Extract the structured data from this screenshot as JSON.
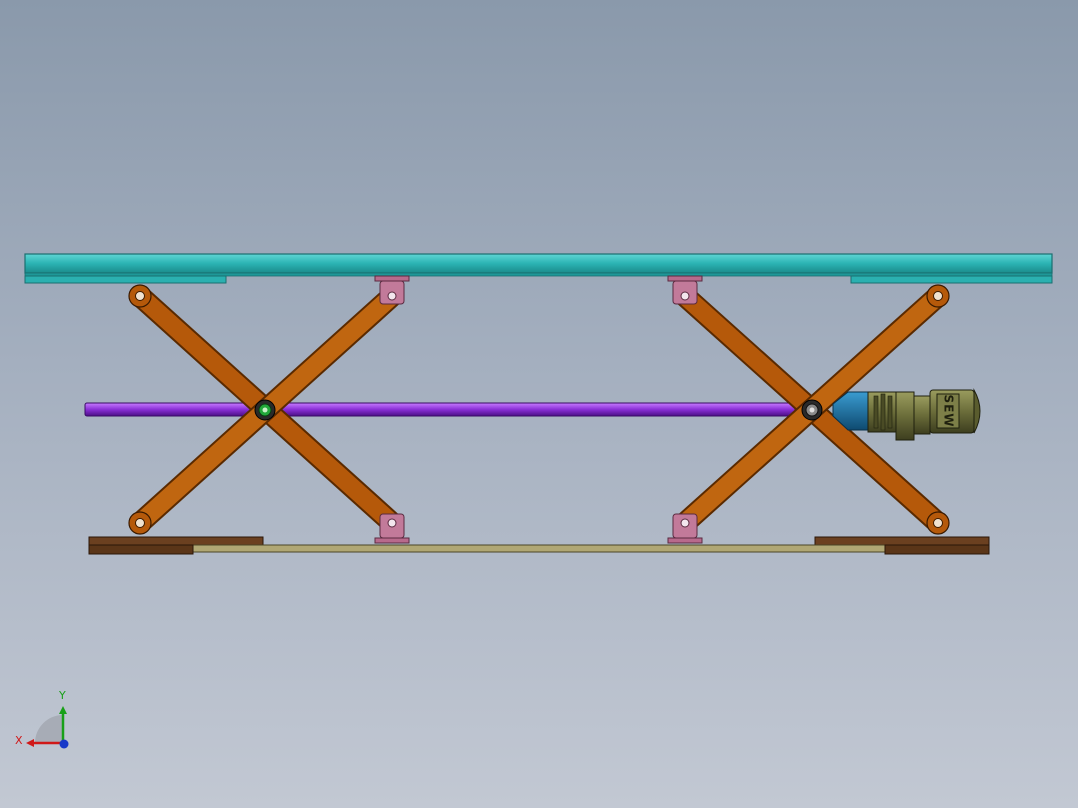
{
  "motor": {
    "brand_text": "SEW"
  },
  "triad": {
    "x_label": "X",
    "y_label": "Y"
  },
  "colors": {
    "platform": "#2fb8b8",
    "platform_edge": "#1a6f70",
    "scissor_arm": "#b5590a",
    "scissor_arm_edge": "#5a2a00",
    "bracket": "#c27a9a",
    "shaft": "#8a2fd6",
    "base_rail": "#5a3518",
    "base_bar": "#b0a774",
    "motor_body": "#6b6d3a",
    "motor_adapter": "#1d6c9a",
    "x_axis": "#d01818",
    "y_axis": "#18a018",
    "z_axis": "#1838c8"
  }
}
